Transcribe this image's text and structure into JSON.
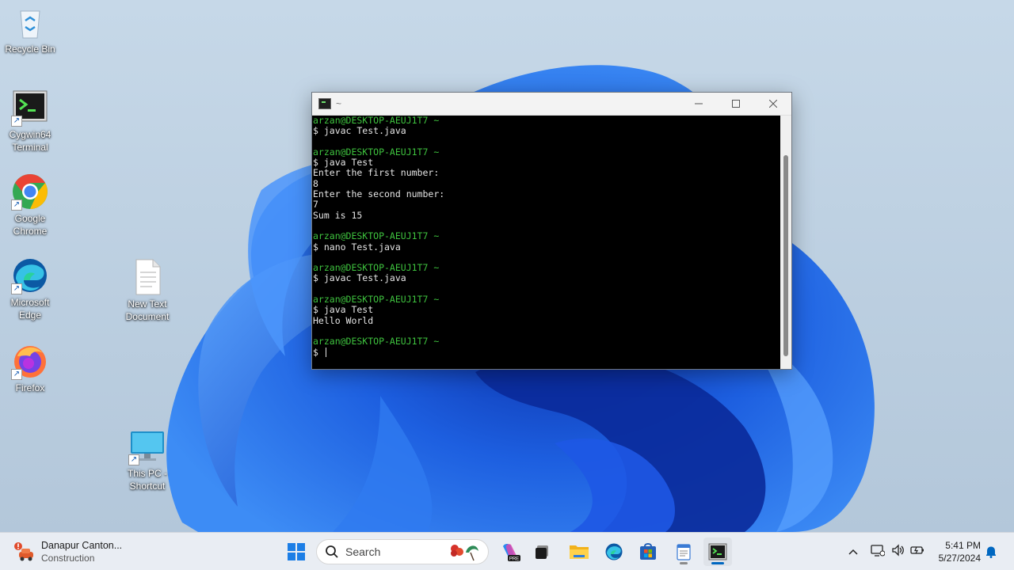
{
  "desktop": {
    "icons": [
      {
        "label": "Recycle Bin"
      },
      {
        "label": "Cygwin64 Terminal"
      },
      {
        "label": "Google Chrome"
      },
      {
        "label": "Microsoft Edge"
      },
      {
        "label": "Firefox"
      },
      {
        "label": "New Text Document"
      },
      {
        "label": "This PC - Shortcut"
      }
    ]
  },
  "terminal": {
    "title": "~",
    "lines": [
      {
        "text": "arzan@DESKTOP-AEUJ1T7 ~",
        "kind": "prompt"
      },
      {
        "text": "$ javac Test.java",
        "kind": "cmd"
      },
      {
        "text": "",
        "kind": "blank"
      },
      {
        "text": "arzan@DESKTOP-AEUJ1T7 ~",
        "kind": "prompt"
      },
      {
        "text": "$ java Test",
        "kind": "cmd"
      },
      {
        "text": "Enter the first number:",
        "kind": "out"
      },
      {
        "text": "8",
        "kind": "out"
      },
      {
        "text": "Enter the second number:",
        "kind": "out"
      },
      {
        "text": "7",
        "kind": "out"
      },
      {
        "text": "Sum is 15",
        "kind": "out"
      },
      {
        "text": "",
        "kind": "blank"
      },
      {
        "text": "arzan@DESKTOP-AEUJ1T7 ~",
        "kind": "prompt"
      },
      {
        "text": "$ nano Test.java",
        "kind": "cmd"
      },
      {
        "text": "",
        "kind": "blank"
      },
      {
        "text": "arzan@DESKTOP-AEUJ1T7 ~",
        "kind": "prompt"
      },
      {
        "text": "$ javac Test.java",
        "kind": "cmd"
      },
      {
        "text": "",
        "kind": "blank"
      },
      {
        "text": "arzan@DESKTOP-AEUJ1T7 ~",
        "kind": "prompt"
      },
      {
        "text": "$ java Test",
        "kind": "cmd"
      },
      {
        "text": "Hello World",
        "kind": "out"
      },
      {
        "text": "",
        "kind": "blank"
      },
      {
        "text": "arzan@DESKTOP-AEUJ1T7 ~",
        "kind": "prompt"
      }
    ],
    "current_input": "$ ",
    "colors": {
      "prompt": "#3ec23e",
      "text": "#e5e5e5",
      "background": "#000000"
    }
  },
  "taskbar": {
    "weather": {
      "title": "Danapur Canton...",
      "subtitle": "Construction"
    },
    "search": {
      "label": "Search"
    },
    "pinned": [
      "windows-start",
      "copilot",
      "task-view",
      "file-explorer",
      "microsoft-edge",
      "microsoft-store",
      "notepad",
      "cygwin-terminal"
    ],
    "clock": {
      "time": "5:41 PM",
      "date": "5/27/2024"
    }
  }
}
